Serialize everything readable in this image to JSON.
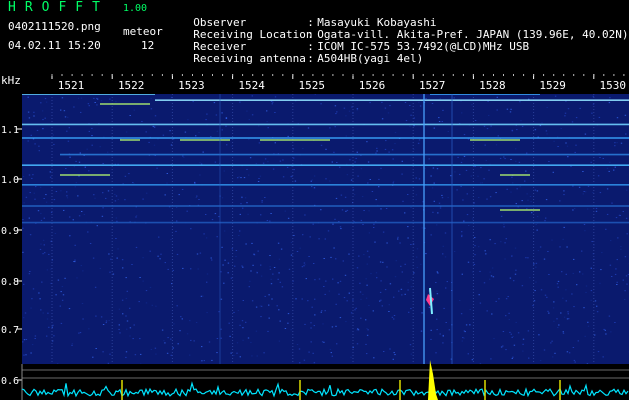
{
  "header": {
    "app_title": "HROFFT",
    "version": "1.00",
    "filename": "0402111520.png",
    "datetime": "04.02.11 15:20",
    "meteor_label": "meteor",
    "meteor_count": "12"
  },
  "info": {
    "separator": ":",
    "rows": [
      {
        "key": "Observer",
        "value": "Masayuki Kobayashi"
      },
      {
        "key": "Receiving Location",
        "value": "Ogata-vill. Akita-Pref. JAPAN (139.96E, 40.02N)"
      },
      {
        "key": "Receiver",
        "value": "ICOM IC-575 53.7492(@LCD)MHz USB"
      },
      {
        "key": "Receiving antenna",
        "value": "A504HB(yagi 4el)"
      }
    ]
  },
  "spectrogram": {
    "unit": "kHz",
    "y_ticks": [
      "1.1",
      "1.0",
      "0.9",
      "0.8",
      "0.7",
      "0.6"
    ],
    "y_values": [
      1.1,
      1.0,
      0.9,
      0.8,
      0.7,
      0.6
    ],
    "x_ticks": [
      "1521",
      "1522",
      "1523",
      "1524",
      "1525",
      "1526",
      "1527",
      "1528",
      "1529",
      "1530"
    ],
    "colors": {
      "noise": "#0a1a6e",
      "line": "#3aa8ff",
      "grid": "#6a6a6a",
      "meteor": "#ffff00",
      "histogram": "#00e5ff",
      "text": "#ffffff"
    }
  }
}
